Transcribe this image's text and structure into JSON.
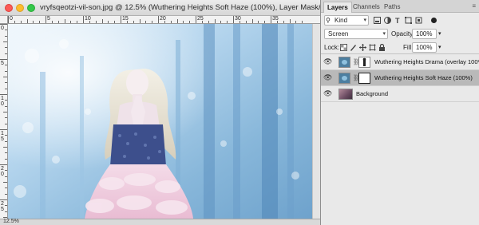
{
  "document": {
    "title": "vryfsqeotzi-vil-son.jpg @ 12.5% (Wuthering Heights Soft Haze (100%), Layer Mask/8) *",
    "zoom_status": "12.5%",
    "ruler_top_labels": [
      "0",
      "5",
      "10",
      "15",
      "20",
      "25",
      "30",
      "35"
    ],
    "ruler_left_labels": [
      "0",
      "5",
      "1\n0",
      "1\n5",
      "2\n0",
      "2\n5"
    ]
  },
  "panel": {
    "tabs": [
      {
        "label": "Layers",
        "active": true
      },
      {
        "label": "Channels",
        "active": false
      },
      {
        "label": "Paths",
        "active": false
      }
    ],
    "filter_kind": "Kind",
    "blend_mode": "Screen",
    "opacity_label": "Opacity:",
    "opacity_value": "100%",
    "lock_label": "Lock:",
    "fill_label": "Fill:",
    "fill_value": "100%",
    "layers": [
      {
        "name": "Wuthering Heights Drama (overlay 100%)",
        "type": "adjustment",
        "selected": false
      },
      {
        "name": "Wuthering Heights Soft Haze (100%)",
        "type": "adjustment",
        "selected": true
      },
      {
        "name": "Background",
        "type": "photo",
        "selected": false
      }
    ]
  },
  "colors": {
    "selected_layer": "#b9b9b9",
    "panel_bg": "#eaeaea",
    "canvas_tint": "#a9cbe4"
  }
}
